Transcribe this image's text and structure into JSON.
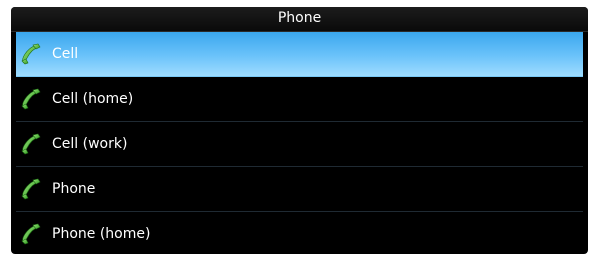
{
  "dialog": {
    "title": "Phone"
  },
  "list": {
    "items": [
      {
        "label": "Cell",
        "icon": "phone-handset-icon",
        "selected": true
      },
      {
        "label": "Cell (home)",
        "icon": "phone-handset-icon",
        "selected": false
      },
      {
        "label": "Cell (work)",
        "icon": "phone-handset-icon",
        "selected": false
      },
      {
        "label": "Phone",
        "icon": "phone-handset-icon",
        "selected": false
      },
      {
        "label": "Phone (home)",
        "icon": "phone-handset-icon",
        "selected": false
      }
    ]
  },
  "colors": {
    "background": "#000000",
    "selection": "#5ab8f6",
    "icon": "#3fbf32",
    "text": "#ffffff"
  }
}
